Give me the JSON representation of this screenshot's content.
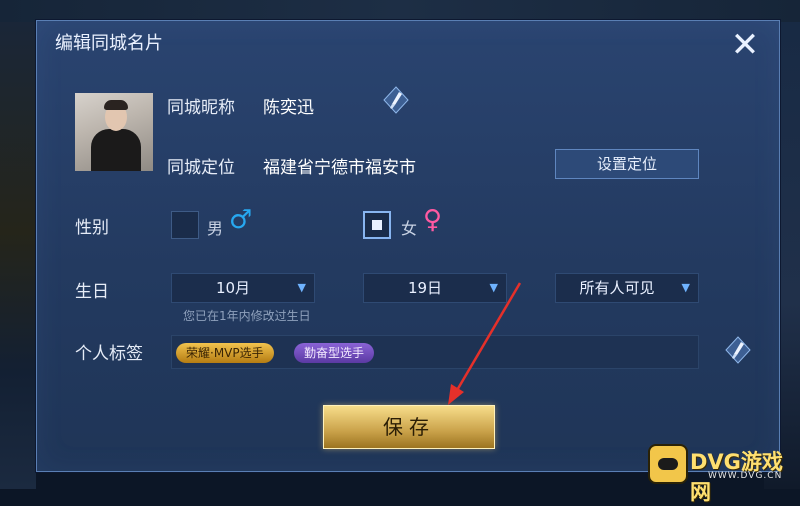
{
  "dialog": {
    "title": "编辑同城名片",
    "close_glyph": "✕"
  },
  "profile": {
    "nickname_label": "同城昵称",
    "nickname_value": "陈奕迅",
    "location_label": "同城定位",
    "location_value": "福建省宁德市福安市",
    "set_location_button": "设置定位"
  },
  "gender": {
    "label": "性别",
    "male_label": "男",
    "female_label": "女",
    "male_symbol": "♂",
    "female_symbol": "♀",
    "selected": "女"
  },
  "birthday": {
    "label": "生日",
    "month_value": "10月",
    "day_value": "19日",
    "visibility_value": "所有人可见",
    "hint": "您已在1年内修改过生日"
  },
  "tags": {
    "label": "个人标签",
    "items": [
      "荣耀·MVP选手",
      "勤奋型选手"
    ]
  },
  "actions": {
    "save_label": "保存"
  },
  "watermark": {
    "brand": "DVG游戏网",
    "url": "WWW.DVG.CN"
  },
  "colors": {
    "dialog_bg": "#233a60",
    "accent_gold": "#caa24a",
    "male_blue": "#27a8f0",
    "female_pink": "#ff5aa2",
    "arrow_red": "#e5302a"
  },
  "icons": {
    "close": "close-icon",
    "edit": "edit-brush-icon",
    "chevron": "chevron-down-icon"
  }
}
